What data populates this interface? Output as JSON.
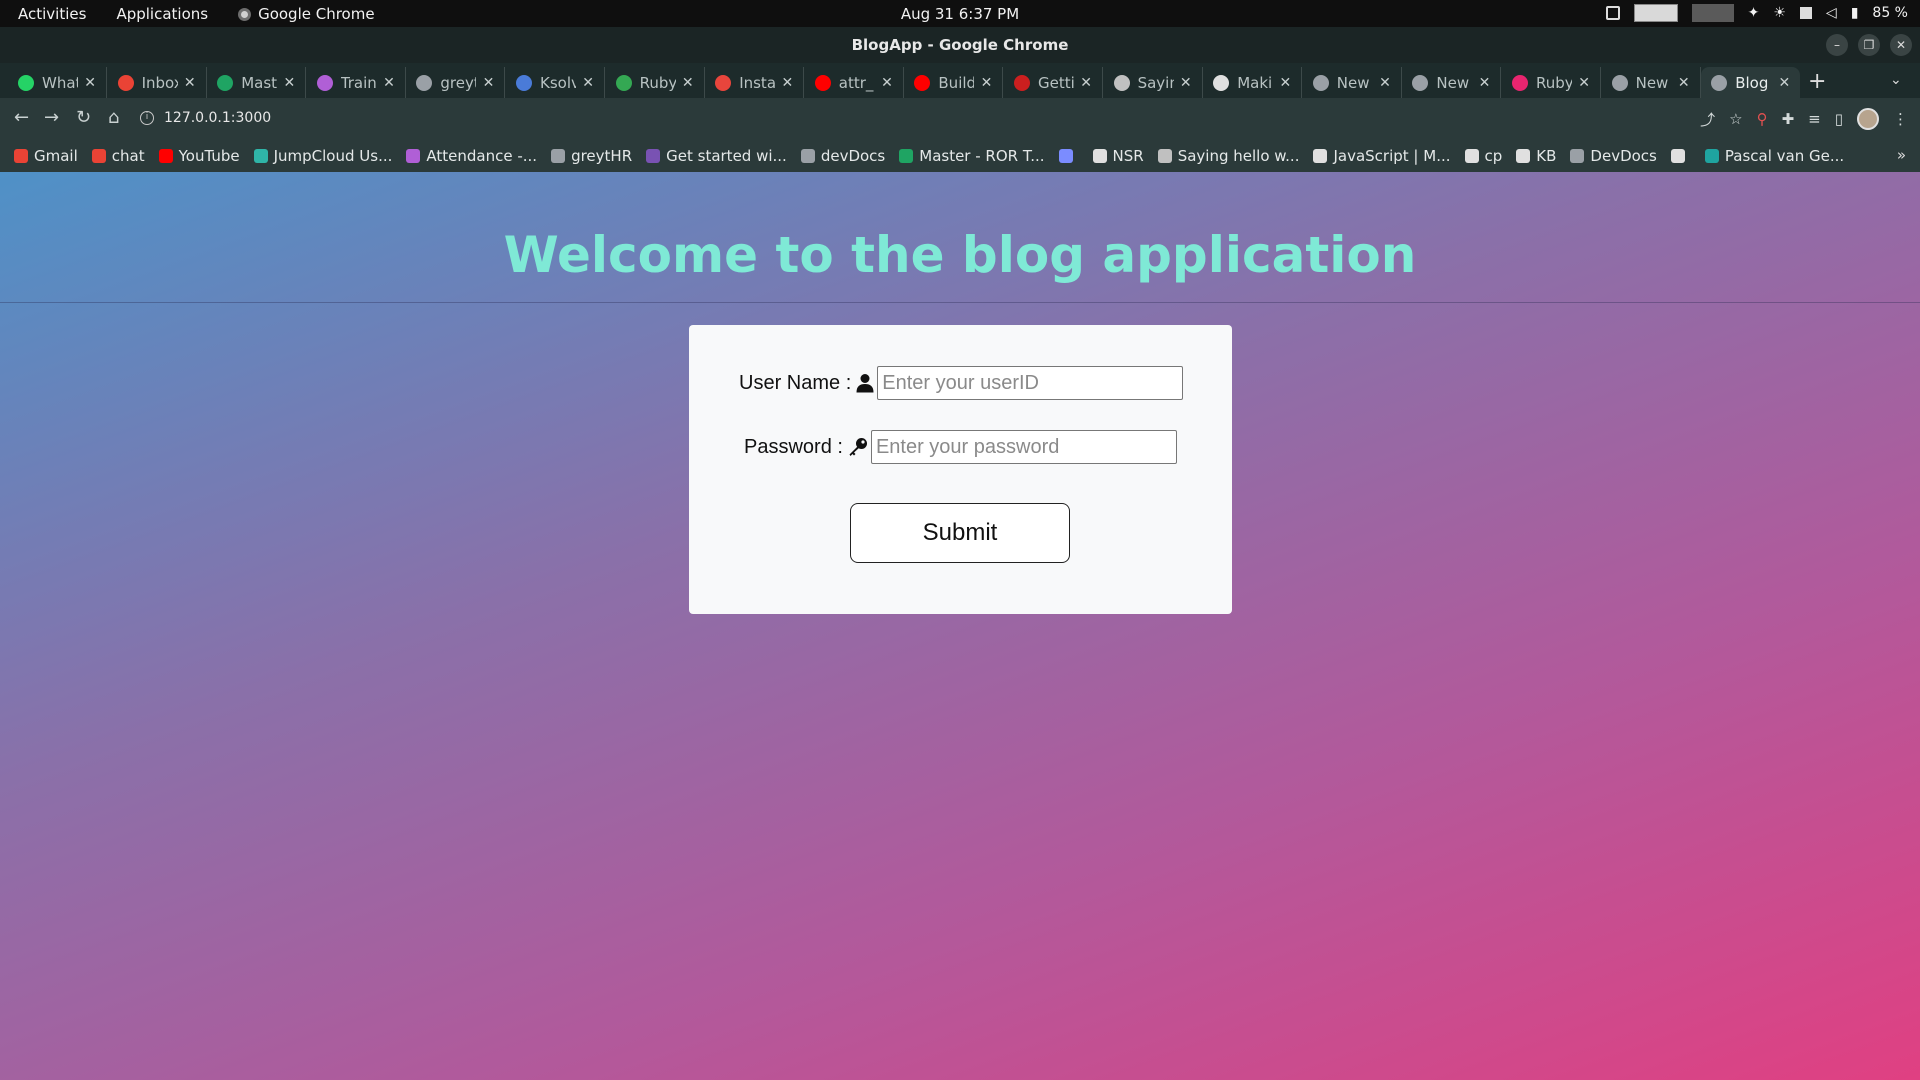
{
  "system": {
    "activities": "Activities",
    "applications": "Applications",
    "app_name": "Google Chrome",
    "clock": "Aug 31  6:37 PM",
    "battery": "85 %"
  },
  "window": {
    "title": "BlogApp - Google Chrome"
  },
  "tabs": [
    {
      "label": "What",
      "color": "#25d366"
    },
    {
      "label": "Inbox",
      "color": "#ea4335"
    },
    {
      "label": "Mast",
      "color": "#1fa463"
    },
    {
      "label": "Train",
      "color": "#b05fd6"
    },
    {
      "label": "greyt",
      "color": "#9aa0a6"
    },
    {
      "label": "Ksolv",
      "color": "#4a7bd8"
    },
    {
      "label": "Ruby",
      "color": "#34a853"
    },
    {
      "label": "Insta",
      "color": "#e8453c"
    },
    {
      "label": "attr_",
      "color": "#ff0000"
    },
    {
      "label": "Build",
      "color": "#ff0000"
    },
    {
      "label": "Getti",
      "color": "#cc1f1f"
    },
    {
      "label": "Sayin",
      "color": "#c0c0c0"
    },
    {
      "label": "Maki",
      "color": "#e0e0e0"
    },
    {
      "label": "New",
      "color": "#9aa0a6"
    },
    {
      "label": "New",
      "color": "#9aa0a6"
    },
    {
      "label": "Ruby",
      "color": "#e8256f"
    },
    {
      "label": "New",
      "color": "#9aa0a6"
    },
    {
      "label": "Blog",
      "color": "#9aa0a6"
    }
  ],
  "address": {
    "url": "127.0.0.1:3000"
  },
  "bookmarks": [
    {
      "label": "Gmail",
      "color": "#ea4335"
    },
    {
      "label": "chat",
      "color": "#ea4335"
    },
    {
      "label": "YouTube",
      "color": "#ff0000"
    },
    {
      "label": "JumpCloud Us...",
      "color": "#2fb5a8"
    },
    {
      "label": "Attendance -...",
      "color": "#b05fd6"
    },
    {
      "label": "greytHR",
      "color": "#9aa0a6"
    },
    {
      "label": "Get started wi...",
      "color": "#7952b3"
    },
    {
      "label": "devDocs",
      "color": "#9aa0a6"
    },
    {
      "label": "Master - ROR T...",
      "color": "#1fa463"
    },
    {
      "label": "",
      "color": "#7b8cff"
    },
    {
      "label": "NSR",
      "color": "#e0e0e0"
    },
    {
      "label": "Saying hello w...",
      "color": "#c0c0c0"
    },
    {
      "label": "JavaScript | M...",
      "color": "#e0e0e0"
    },
    {
      "label": "cp",
      "color": "#e0e0e0"
    },
    {
      "label": "KB",
      "color": "#e0e0e0"
    },
    {
      "label": "DevDocs",
      "color": "#9aa0a6"
    },
    {
      "label": "",
      "color": "#e0e0e0"
    },
    {
      "label": "Pascal van Ge...",
      "color": "#1fa4a0"
    }
  ],
  "page": {
    "heading": "Welcome to the blog application",
    "username_label": "User Name :",
    "username_placeholder": "Enter your userID",
    "password_label": "Password :",
    "password_placeholder": "Enter your password",
    "submit_label": "Submit"
  }
}
